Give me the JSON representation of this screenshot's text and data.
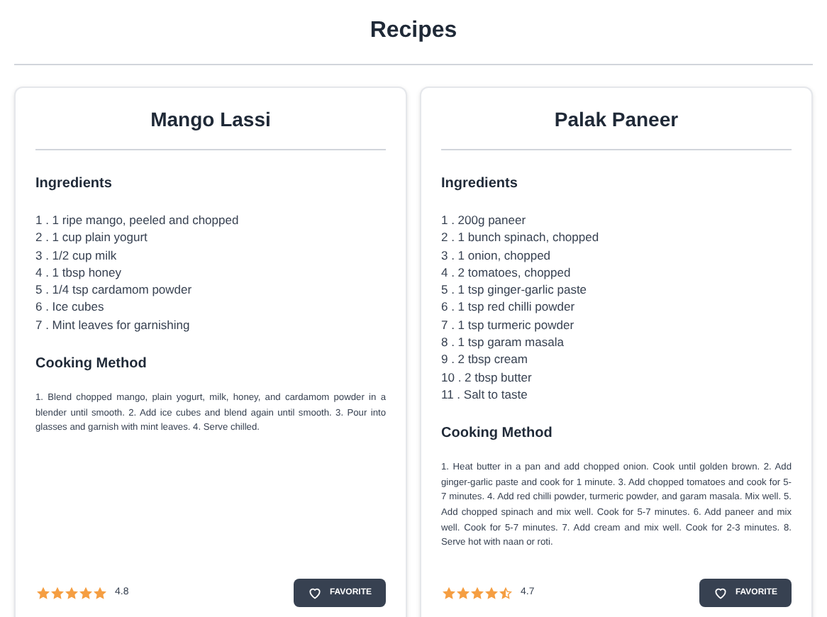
{
  "page": {
    "title": "Recipes"
  },
  "recipes": [
    {
      "name": "Mango Lassi",
      "ingredients_heading": "Ingredients",
      "ingredients": [
        "1 . 1 ripe mango, peeled and chopped",
        "2 . 1 cup plain yogurt",
        "3 . 1/2 cup milk",
        "4 . 1 tbsp honey",
        "5 . 1/4 tsp cardamom powder",
        "6 . Ice cubes",
        "7 . Mint leaves for garnishing"
      ],
      "method_heading": "Cooking Method",
      "method": "1. Blend chopped mango, plain yogurt, milk, honey, and cardamom powder in a blender until smooth. 2. Add ice cubes and blend again until smooth. 3. Pour into glasses and garnish with mint leaves. 4. Serve chilled.",
      "stars": 5,
      "rating": "4.8",
      "button": "FAVORITE"
    },
    {
      "name": "Palak Paneer",
      "ingredients_heading": "Ingredients",
      "ingredients": [
        "1 . 200g paneer",
        "2 . 1 bunch spinach, chopped",
        "3 . 1 onion, chopped",
        "4 . 2 tomatoes, chopped",
        "5 . 1 tsp ginger-garlic paste",
        "6 . 1 tsp red chilli powder",
        "7 . 1 tsp turmeric powder",
        "8 . 1 tsp garam masala",
        "9 . 2 tbsp cream",
        "10 . 2 tbsp butter",
        "11 . Salt to taste"
      ],
      "method_heading": "Cooking Method",
      "method": "1. Heat butter in a pan and add chopped onion. Cook until golden brown. 2. Add ginger-garlic paste and cook for 1 minute. 3. Add chopped tomatoes and cook for 5-7 minutes. 4. Add red chilli powder, turmeric powder, and garam masala. Mix well. 5. Add chopped spinach and mix well. Cook for 5-7 minutes. 6. Add paneer and mix well. Cook for 5-7 minutes. 7. Add cream and mix well. Cook for 2-3 minutes. 8. Serve hot with naan or roti.",
      "stars": 4.5,
      "rating": "4.7",
      "button": "FAVORITE"
    }
  ]
}
